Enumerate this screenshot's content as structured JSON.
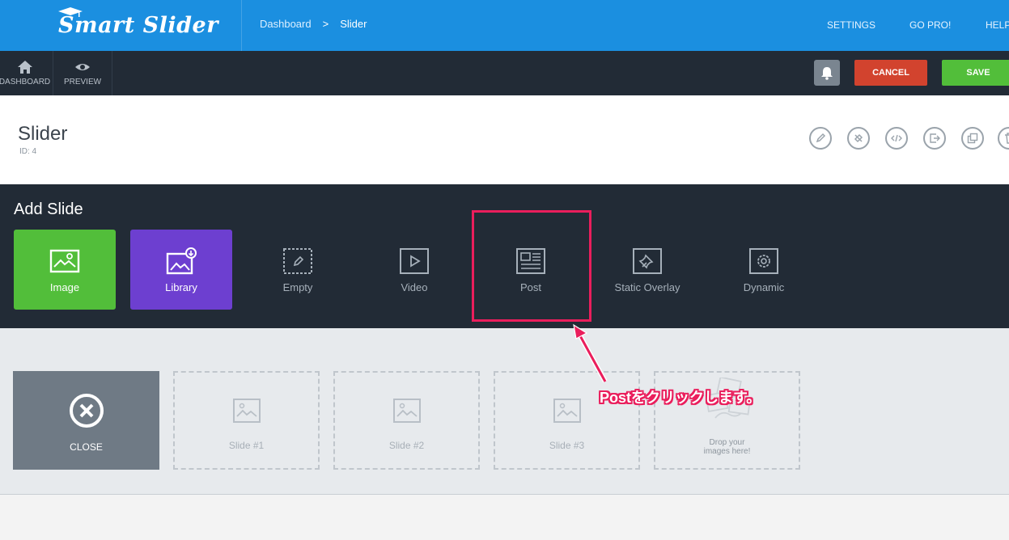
{
  "app": {
    "logo_text": "Smart Slider"
  },
  "breadcrumb": {
    "items": [
      "Dashboard",
      "Slider"
    ],
    "separator": ">"
  },
  "topnav": {
    "items": [
      "SETTINGS",
      "GO PRO!",
      "HELP"
    ]
  },
  "toolbar": {
    "dashboard_label": "DASHBOARD",
    "preview_label": "PREVIEW",
    "cancel_label": "CANCEL",
    "save_label": "SAVE"
  },
  "header": {
    "title": "Slider",
    "id_text": "ID: 4",
    "actions": [
      "pencil-icon",
      "brush-icon",
      "code-icon",
      "export-icon",
      "duplicate-icon",
      "trash-icon"
    ]
  },
  "add_slide": {
    "title": "Add Slide",
    "tiles": [
      {
        "label": "Image",
        "icon": "image-icon"
      },
      {
        "label": "Library",
        "icon": "library-icon"
      },
      {
        "label": "Empty",
        "icon": "empty-icon"
      },
      {
        "label": "Video",
        "icon": "video-icon"
      },
      {
        "label": "Post",
        "icon": "post-icon"
      },
      {
        "label": "Static Overlay",
        "icon": "pin-icon"
      },
      {
        "label": "Dynamic",
        "icon": "gear-icon"
      }
    ]
  },
  "slides": {
    "close_label": "CLOSE",
    "items": [
      "Slide #1",
      "Slide #2",
      "Slide #3"
    ],
    "drop_line1": "Drop your",
    "drop_line2": "images here!"
  },
  "annotation": {
    "text": "Postをクリックします。"
  },
  "colors": {
    "topbar": "#1b8fe0",
    "dark": "#222b36",
    "green": "#52be3a",
    "purple": "#6d3fd0",
    "cancel": "#d2432e",
    "highlight": "#ea1e5c"
  }
}
